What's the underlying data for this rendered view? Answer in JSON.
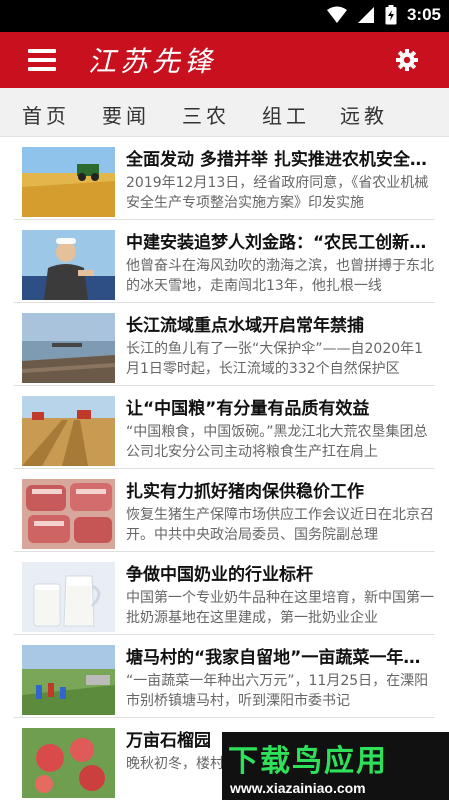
{
  "status_bar": {
    "time": "3:05"
  },
  "app_bar": {
    "title": "江苏先锋"
  },
  "tabs": [
    {
      "label": "首页"
    },
    {
      "label": "要闻"
    },
    {
      "label": "三农"
    },
    {
      "label": "组工"
    },
    {
      "label": "远教"
    }
  ],
  "news": [
    {
      "title": "全面发动 多措并举 扎实推进农机安全生产",
      "summary": "2019年12月13日，经省政府同意，《省农业机械安全生产专项整治实施方案》印发实施"
    },
    {
      "title": "中建安装追梦人刘金路：“农民工创新之星”",
      "summary": "他曾奋斗在海风劲吹的渤海之滨，也曾拼搏于东北的冰天雪地，走南闯北13年，他扎根一线"
    },
    {
      "title": "长江流域重点水域开启常年禁捕",
      "summary": "长江的鱼儿有了一张“大保护伞”——自2020年1月1日零时起，长江流域的332个自然保护区"
    },
    {
      "title": "让“中国粮”有分量有品质有效益",
      "summary": "“中国粮食，中国饭碗。”黑龙江北大荒农垦集团总公司北安分公司主动将粮食生产扛在肩上"
    },
    {
      "title": "扎实有力抓好猪肉保供稳价工作",
      "summary": "恢复生猪生产保障市场供应工作会议近日在北京召开。中共中央政治局委员、国务院副总理"
    },
    {
      "title": "争做中国奶业的行业标杆",
      "summary": "中国第一个专业奶牛品种在这里培育，新中国第一批奶源基地在这里建成，第一批奶业企业"
    },
    {
      "title": "塘马村的“我家自留地”一亩蔬菜一年种出六万元",
      "summary": "“一亩蔬菜一年种出六万元”，11月25日，在溧阳市别桥镇塘马村，听到溧阳市委书记"
    },
    {
      "title": "万亩石榴园",
      "summary": "晚秋初冬，楼村，五亩"
    }
  ],
  "watermark": {
    "logo_text": "下载鸟应用",
    "url": "www.xiazainiao.com"
  }
}
